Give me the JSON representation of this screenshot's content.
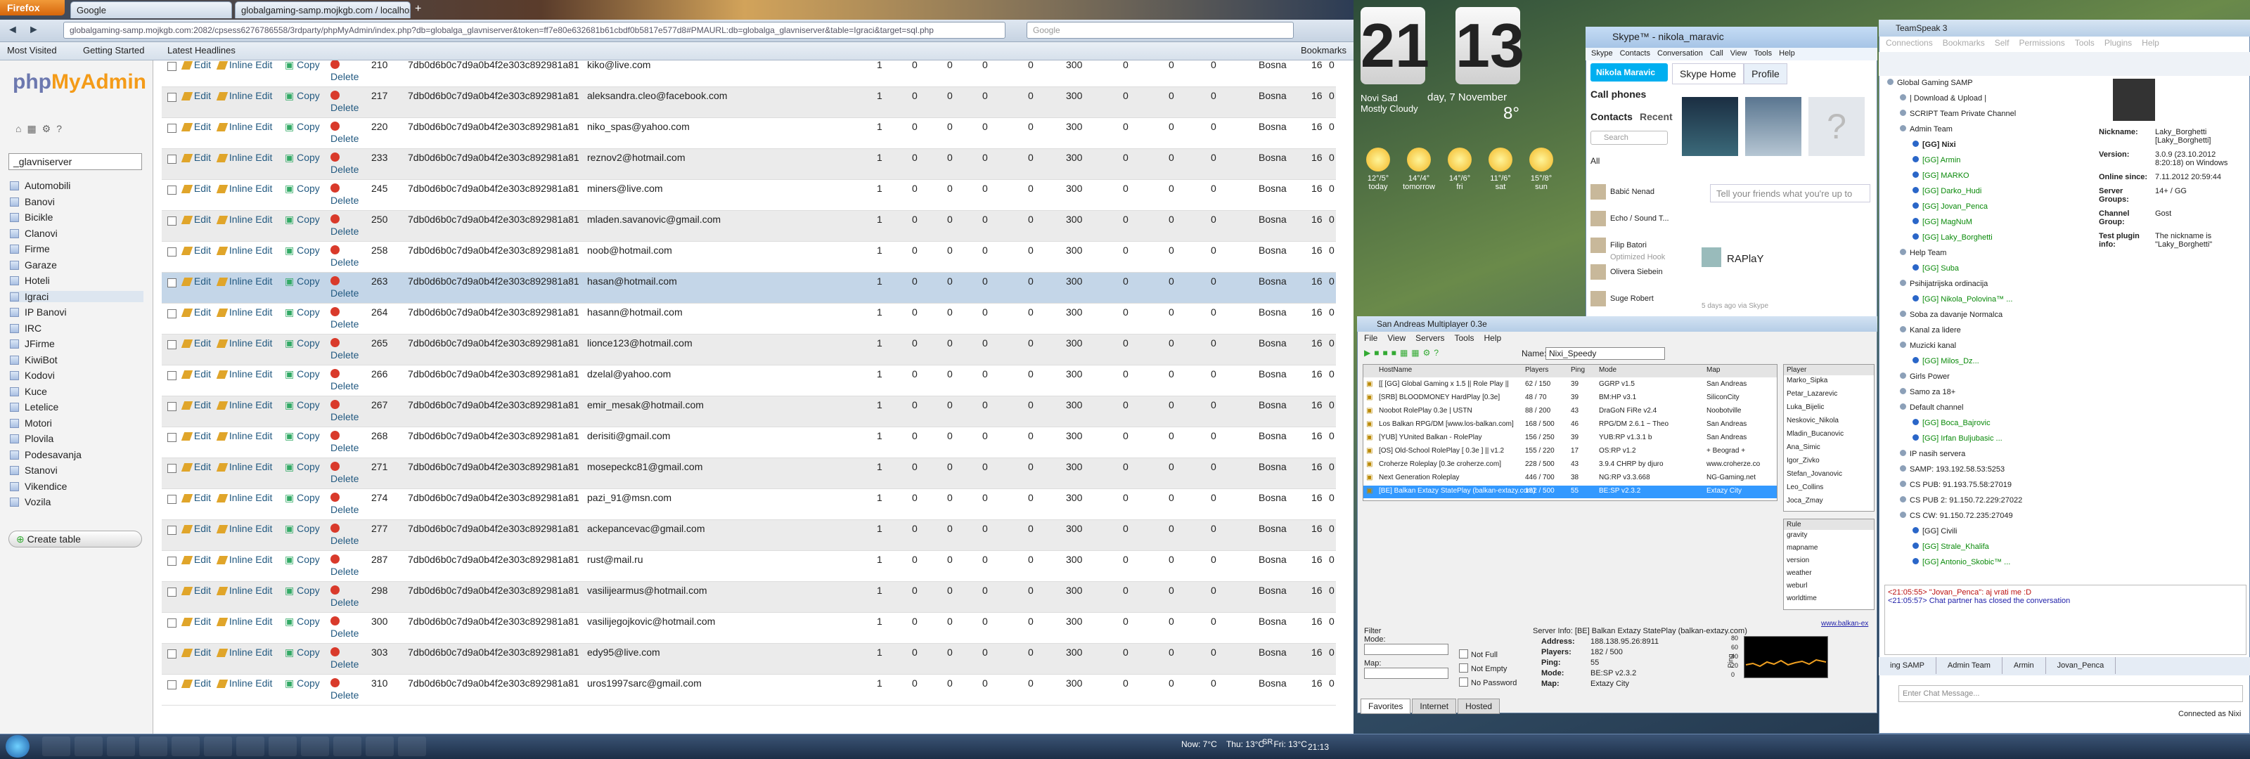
{
  "firefox": {
    "menu": "Firefox",
    "tabs": [
      "Google",
      "globalgaming-samp.mojkgb.com / localhost / ..."
    ],
    "url": "globalgaming-samp.mojkgb.com:2082/cpsess6276786558/3rdparty/phpMyAdmin/index.php?db=globalga_glavniserver&token=ff7e80e632681b61cbdf0b5817e577d8#PMAURL:db=globalga_glavniserver&table=Igraci&target=sql.php",
    "search_placeholder": "Google",
    "bookmarks": [
      "Most Visited",
      "Getting Started",
      "Latest Headlines"
    ],
    "bookmarks_right": "Bookmarks"
  },
  "pma": {
    "logo_a": "php",
    "logo_b": "MyAdmin",
    "db": "_glavniserver",
    "tables": [
      "Automobili",
      "Banovi",
      "Bicikle",
      "Clanovi",
      "Firme",
      "Garaze",
      "Hoteli",
      "Igraci",
      "IP Banovi",
      "IRC",
      "JFirme",
      "KiwiBot",
      "Kodovi",
      "Kuce",
      "Letelice",
      "Motori",
      "Plovila",
      "Podesavanja",
      "Stanovi",
      "Vikendice",
      "Vozila"
    ],
    "create_table": "Create table",
    "actions": {
      "edit": "Edit",
      "inline": "Inline Edit",
      "copy": "Copy",
      "delete": "Delete"
    },
    "rows": [
      {
        "id": "210",
        "hash": "7db0d6b0c7d9a0b4f2e303c892981a81",
        "email": "kiko@live.com",
        "vals": [
          "1",
          "0",
          "0",
          "0",
          "0",
          "300",
          "0",
          "0",
          "0"
        ],
        "city": "Bosna",
        "n": "16",
        "z": "0"
      },
      {
        "id": "217",
        "hash": "7db0d6b0c7d9a0b4f2e303c892981a81",
        "email": "aleksandra.cleo@facebook.com",
        "vals": [
          "1",
          "0",
          "0",
          "0",
          "0",
          "300",
          "0",
          "0",
          "0"
        ],
        "city": "Bosna",
        "n": "16",
        "z": "0"
      },
      {
        "id": "220",
        "hash": "7db0d6b0c7d9a0b4f2e303c892981a81",
        "email": "niko_spas@yahoo.com",
        "vals": [
          "1",
          "0",
          "0",
          "0",
          "0",
          "300",
          "0",
          "0",
          "0"
        ],
        "city": "Bosna",
        "n": "16",
        "z": "0"
      },
      {
        "id": "233",
        "hash": "7db0d6b0c7d9a0b4f2e303c892981a81",
        "email": "reznov2@hotmail.com",
        "vals": [
          "1",
          "0",
          "0",
          "0",
          "0",
          "300",
          "0",
          "0",
          "0"
        ],
        "city": "Bosna",
        "n": "16",
        "z": "0"
      },
      {
        "id": "245",
        "hash": "7db0d6b0c7d9a0b4f2e303c892981a81",
        "email": "miners@live.com",
        "vals": [
          "1",
          "0",
          "0",
          "0",
          "0",
          "300",
          "0",
          "0",
          "0"
        ],
        "city": "Bosna",
        "n": "16",
        "z": "0"
      },
      {
        "id": "250",
        "hash": "7db0d6b0c7d9a0b4f2e303c892981a81",
        "email": "mladen.savanovic@gmail.com",
        "vals": [
          "1",
          "0",
          "0",
          "0",
          "0",
          "300",
          "0",
          "0",
          "0"
        ],
        "city": "Bosna",
        "n": "16",
        "z": "0"
      },
      {
        "id": "258",
        "hash": "7db0d6b0c7d9a0b4f2e303c892981a81",
        "email": "noob@hotmail.com",
        "vals": [
          "1",
          "0",
          "0",
          "0",
          "0",
          "300",
          "0",
          "0",
          "0"
        ],
        "city": "Bosna",
        "n": "16",
        "z": "0"
      },
      {
        "id": "263",
        "hash": "7db0d6b0c7d9a0b4f2e303c892981a81",
        "email": "hasan@hotmail.com",
        "vals": [
          "1",
          "0",
          "0",
          "0",
          "0",
          "300",
          "0",
          "0",
          "0"
        ],
        "city": "Bosna",
        "n": "16",
        "z": "0"
      },
      {
        "id": "264",
        "hash": "7db0d6b0c7d9a0b4f2e303c892981a81",
        "email": "hasann@hotmail.com",
        "vals": [
          "1",
          "0",
          "0",
          "0",
          "0",
          "300",
          "0",
          "0",
          "0"
        ],
        "city": "Bosna",
        "n": "16",
        "z": "0"
      },
      {
        "id": "265",
        "hash": "7db0d6b0c7d9a0b4f2e303c892981a81",
        "email": "lionce123@hotmail.com",
        "vals": [
          "1",
          "0",
          "0",
          "0",
          "0",
          "300",
          "0",
          "0",
          "0"
        ],
        "city": "Bosna",
        "n": "16",
        "z": "0"
      },
      {
        "id": "266",
        "hash": "7db0d6b0c7d9a0b4f2e303c892981a81",
        "email": "dzelal@yahoo.com",
        "vals": [
          "1",
          "0",
          "0",
          "0",
          "0",
          "300",
          "0",
          "0",
          "0"
        ],
        "city": "Bosna",
        "n": "16",
        "z": "0"
      },
      {
        "id": "267",
        "hash": "7db0d6b0c7d9a0b4f2e303c892981a81",
        "email": "emir_mesak@hotmail.com",
        "vals": [
          "1",
          "0",
          "0",
          "0",
          "0",
          "300",
          "0",
          "0",
          "0"
        ],
        "city": "Bosna",
        "n": "16",
        "z": "0"
      },
      {
        "id": "268",
        "hash": "7db0d6b0c7d9a0b4f2e303c892981a81",
        "email": "derisiti@gmail.com",
        "vals": [
          "1",
          "0",
          "0",
          "0",
          "0",
          "300",
          "0",
          "0",
          "0"
        ],
        "city": "Bosna",
        "n": "16",
        "z": "0"
      },
      {
        "id": "271",
        "hash": "7db0d6b0c7d9a0b4f2e303c892981a81",
        "email": "mosepeckc81@gmail.com",
        "vals": [
          "1",
          "0",
          "0",
          "0",
          "0",
          "300",
          "0",
          "0",
          "0"
        ],
        "city": "Bosna",
        "n": "16",
        "z": "0"
      },
      {
        "id": "274",
        "hash": "7db0d6b0c7d9a0b4f2e303c892981a81",
        "email": "pazi_91@msn.com",
        "vals": [
          "1",
          "0",
          "0",
          "0",
          "0",
          "300",
          "0",
          "0",
          "0"
        ],
        "city": "Bosna",
        "n": "16",
        "z": "0"
      },
      {
        "id": "277",
        "hash": "7db0d6b0c7d9a0b4f2e303c892981a81",
        "email": "ackepancevac@gmail.com",
        "vals": [
          "1",
          "0",
          "0",
          "0",
          "0",
          "300",
          "0",
          "0",
          "0"
        ],
        "city": "Bosna",
        "n": "16",
        "z": "0"
      },
      {
        "id": "287",
        "hash": "7db0d6b0c7d9a0b4f2e303c892981a81",
        "email": "rust@mail.ru",
        "vals": [
          "1",
          "0",
          "0",
          "0",
          "0",
          "300",
          "0",
          "0",
          "0"
        ],
        "city": "Bosna",
        "n": "16",
        "z": "0"
      },
      {
        "id": "298",
        "hash": "7db0d6b0c7d9a0b4f2e303c892981a81",
        "email": "vasilijearmus@hotmail.com",
        "vals": [
          "1",
          "0",
          "0",
          "0",
          "0",
          "300",
          "0",
          "0",
          "0"
        ],
        "city": "Bosna",
        "n": "16",
        "z": "0"
      },
      {
        "id": "300",
        "hash": "7db0d6b0c7d9a0b4f2e303c892981a81",
        "email": "vasilijegojkovic@hotmail.com",
        "vals": [
          "1",
          "0",
          "0",
          "0",
          "0",
          "300",
          "0",
          "0",
          "0"
        ],
        "city": "Bosna",
        "n": "16",
        "z": "0"
      },
      {
        "id": "303",
        "hash": "7db0d6b0c7d9a0b4f2e303c892981a81",
        "email": "edy95@live.com",
        "vals": [
          "1",
          "0",
          "0",
          "0",
          "0",
          "300",
          "0",
          "0",
          "0"
        ],
        "city": "Bosna",
        "n": "16",
        "z": "0"
      },
      {
        "id": "310",
        "hash": "7db0d6b0c7d9a0b4f2e303c892981a81",
        "email": "uros1997sarc@gmail.com",
        "vals": [
          "1",
          "0",
          "0",
          "0",
          "0",
          "300",
          "0",
          "0",
          "0"
        ],
        "city": "Bosna",
        "n": "16",
        "z": "0"
      }
    ],
    "selected_id": "263"
  },
  "desktop": {
    "hour": "21",
    "minute": "13",
    "location": "Novi Sad",
    "condition": "Mostly Cloudy",
    "date": "day, 7 November",
    "temp": "8°",
    "forecast": [
      {
        "t": "12°/5°",
        "d": "today"
      },
      {
        "t": "14°/4°",
        "d": "tomorrow"
      },
      {
        "t": "14°/6°",
        "d": "fri"
      },
      {
        "t": "11°/6°",
        "d": "sat"
      },
      {
        "t": "15°/8°",
        "d": "sun"
      }
    ]
  },
  "skype": {
    "title": "Skype™ - nikola_maravic",
    "menu": [
      "Skype",
      "Contacts",
      "Conversation",
      "Call",
      "View",
      "Tools",
      "Help"
    ],
    "user": "Nikola Maravic",
    "call_phones": "Call phones",
    "tabs": [
      "Contacts",
      "Recent"
    ],
    "search": "Search",
    "all": "All",
    "contacts": [
      "Babić Nenad",
      "Echo / Sound T...",
      "Filip Batori",
      "Olivera Siebein",
      "Suge Robert"
    ],
    "contact_sub": "Optimized Hook",
    "home_tabs": [
      "Skype Home",
      "Profile"
    ],
    "status_placeholder": "Tell your friends what you're up to",
    "feed_name": "RAPlaY",
    "feed_time": "5 days ago via Skype"
  },
  "samp": {
    "title": "San Andreas Multiplayer 0.3e",
    "menu": [
      "File",
      "View",
      "Servers",
      "Tools",
      "Help"
    ],
    "name_label": "Name:",
    "name": "Nixi_Speedy",
    "headers": [
      "HostName",
      "Players",
      "Ping",
      "Mode",
      "Map"
    ],
    "servers": [
      [
        "[[ [GG] Global Gaming x 1.5 || Role Play ||",
        "62 / 150",
        "39",
        "GGRP v1.5",
        "San Andreas"
      ],
      [
        "[SRB] BLOODMONEY HardPlay [0.3e]",
        "48 / 70",
        "39",
        "BM:HP v3.1",
        "SiliconCity"
      ],
      [
        "Noobot RolePlay 0.3e | USTN",
        "88 / 200",
        "43",
        "DraGoN FiRe v2.4",
        "Noobotville"
      ],
      [
        "Los Balkan RPG/DM [www.los-balkan.com]",
        "168 / 500",
        "46",
        "RPG/DM 2.6.1 ~ Theo",
        "San Andreas"
      ],
      [
        "[YUB] YUnited Balkan - RolePlay",
        "156 / 250",
        "39",
        "YUB:RP v1.3.1 b",
        "San Andreas"
      ],
      [
        "[OS] Old-School RolePlay [ 0.3e ] || v1.2",
        "155 / 220",
        "17",
        "OS:RP v1.2",
        "+ Beograd +"
      ],
      [
        "Croherze Roleplay [0.3e croherze.com]",
        "228 / 500",
        "43",
        "3.9.4 CHRP by djuro",
        "www.croherze.co"
      ],
      [
        "Next Generation Roleplay",
        "446 / 700",
        "38",
        "NG:RP v3.3.668",
        "NG-Gaming.net"
      ],
      [
        "[BE] Balkan Extazy StatePlay (balkan-extazy.com)",
        "182 / 500",
        "55",
        "BE:SP v2.3.2",
        "Extazy City"
      ]
    ],
    "players_header": "Player",
    "players": [
      "Marko_Sipka",
      "Petar_Lazarevic",
      "Luka_Bijelic",
      "Neskovic_Nikola",
      "Mladin_Bucanovic",
      "Ana_Simic",
      "Igor_Zivko",
      "Stefan_Jovanovic",
      "Leo_Collins",
      "Joca_Zmay"
    ],
    "rules_header": "Rule",
    "rules": [
      "gravity",
      "mapname",
      "version",
      "weather",
      "weburl",
      "worldtime"
    ],
    "rules_link": "www.balkan-ex",
    "filter": "Filter",
    "filter_mode": "Mode:",
    "filter_map": "Map:",
    "filter_opts": [
      "Not Full",
      "Not Empty",
      "No Password"
    ],
    "info_title": "Server Info: [BE] Balkan Extazy StatePlay (balkan-extazy.com)",
    "info": [
      [
        "Address:",
        "188.138.95.26:8911"
      ],
      [
        "Players:",
        "182 / 500"
      ],
      [
        "Ping:",
        "55"
      ],
      [
        "Mode:",
        "BE:SP v2.3.2"
      ],
      [
        "Map:",
        "Extazy City"
      ]
    ],
    "ping_label": "Ping",
    "ping_ticks": [
      "80",
      "60",
      "40",
      "20",
      "0"
    ],
    "tabs": [
      "Favorites",
      "Internet",
      "Hosted"
    ]
  },
  "teamspeak": {
    "title": "TeamSpeak 3",
    "menu": [
      "Connections",
      "Bookmarks",
      "Self",
      "Permissions",
      "Tools",
      "Plugins",
      "Help"
    ],
    "tree": [
      {
        "t": "Global Gaming SAMP",
        "c": "b"
      },
      {
        "t": "| Download & Upload |",
        "c": ""
      },
      {
        "t": "SCRIPT Team Private Channel",
        "c": ""
      },
      {
        "t": "Admin Team",
        "c": ""
      },
      {
        "t": "[GG] Nixi",
        "c": "bold"
      },
      {
        "t": "[GG] Armin",
        "c": "g"
      },
      {
        "t": "[GG] MARKO",
        "c": "g"
      },
      {
        "t": "[GG] Darko_Hudi",
        "c": "g"
      },
      {
        "t": "[GG] Jovan_Penca",
        "c": "g"
      },
      {
        "t": "[GG] MagNuM",
        "c": "g"
      },
      {
        "t": "[GG] Laky_Borghetti",
        "c": "g"
      },
      {
        "t": "Help Team",
        "c": ""
      },
      {
        "t": "[GG] Suba",
        "c": "g"
      },
      {
        "t": "Psihijatrijska ordinacija",
        "c": ""
      },
      {
        "t": "[GG] Nikola_Polovina™ ...",
        "c": "g"
      },
      {
        "t": "Soba za davanje Normalca",
        "c": ""
      },
      {
        "t": "Kanal za lidere",
        "c": ""
      },
      {
        "t": "Muzicki kanal",
        "c": ""
      },
      {
        "t": "[GG] Milos_Dz...",
        "c": "g"
      },
      {
        "t": "Girls Power",
        "c": ""
      },
      {
        "t": "Samo za 18+",
        "c": ""
      },
      {
        "t": "Default channel",
        "c": ""
      },
      {
        "t": "[GG] Boca_Bajrovic",
        "c": "g"
      },
      {
        "t": "[GG] Irfan Buljubasic ...",
        "c": "g"
      },
      {
        "t": "IP nasih servera",
        "c": ""
      },
      {
        "t": "SAMP: 193.192.58.53:5253",
        "c": ""
      },
      {
        "t": "CS PUB: 91.193.75.58:27019",
        "c": ""
      },
      {
        "t": "CS PUB 2: 91.150.72.229:27022",
        "c": ""
      },
      {
        "t": "CS CW: 91.150.72.235:27049",
        "c": ""
      },
      {
        "t": "[GG] Civili",
        "c": ""
      },
      {
        "t": "[GG] Strale_Khalifa",
        "c": "g"
      },
      {
        "t": "[GG] Antonio_Skobic™ ...",
        "c": "g"
      }
    ],
    "info": [
      [
        "Nickname:",
        "Laky_Borghetti [Laky_Borghetti]"
      ],
      [
        "Version:",
        "3.0.9 (23.10.2012 8:20:18) on Windows"
      ],
      [
        "Online since:",
        "7.11.2012 20:59:44"
      ],
      [
        "Server Groups:",
        "14+ / GG"
      ],
      [
        "Channel Group:",
        "Gost"
      ],
      [
        "Test plugin info:",
        "The nickname is \"Laky_Borghetti\""
      ]
    ],
    "chat": [
      {
        "t": "<21:05:55> \"Jovan_Penca\": aj vrati me :D",
        "c": "#b11"
      },
      {
        "t": "<21:05:57> Chat partner has closed the conversation",
        "c": "#22a"
      }
    ],
    "chat_tabs": [
      "ing SAMP",
      "Admin Team",
      "Armin",
      "Jovan_Penca"
    ],
    "chat_input": "Enter Chat Message...",
    "connected": "Connected as Nixi"
  },
  "taskbar": {
    "weather_now": "Now: 7°C",
    "weather_thu": "Thu: 13°C",
    "weather_fri": "Fri: 13°C",
    "lang": "SR",
    "time": "21:13"
  }
}
